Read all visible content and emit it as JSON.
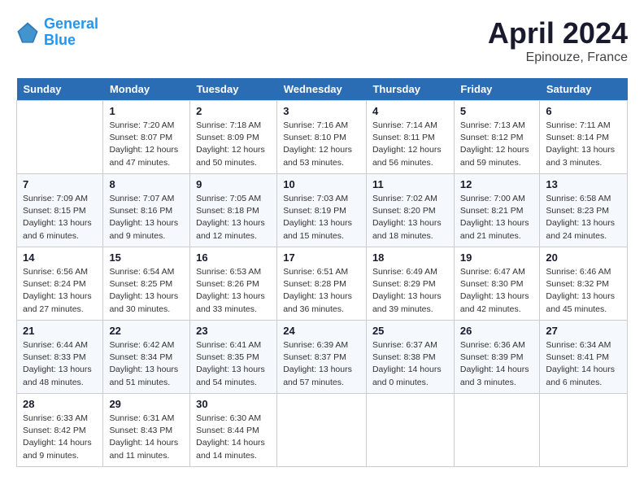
{
  "header": {
    "logo_line1": "General",
    "logo_line2": "Blue",
    "main_title": "April 2024",
    "subtitle": "Epinouze, France"
  },
  "calendar": {
    "days_of_week": [
      "Sunday",
      "Monday",
      "Tuesday",
      "Wednesday",
      "Thursday",
      "Friday",
      "Saturday"
    ],
    "weeks": [
      [
        {
          "day": "",
          "info": ""
        },
        {
          "day": "1",
          "info": "Sunrise: 7:20 AM\nSunset: 8:07 PM\nDaylight: 12 hours\nand 47 minutes."
        },
        {
          "day": "2",
          "info": "Sunrise: 7:18 AM\nSunset: 8:09 PM\nDaylight: 12 hours\nand 50 minutes."
        },
        {
          "day": "3",
          "info": "Sunrise: 7:16 AM\nSunset: 8:10 PM\nDaylight: 12 hours\nand 53 minutes."
        },
        {
          "day": "4",
          "info": "Sunrise: 7:14 AM\nSunset: 8:11 PM\nDaylight: 12 hours\nand 56 minutes."
        },
        {
          "day": "5",
          "info": "Sunrise: 7:13 AM\nSunset: 8:12 PM\nDaylight: 12 hours\nand 59 minutes."
        },
        {
          "day": "6",
          "info": "Sunrise: 7:11 AM\nSunset: 8:14 PM\nDaylight: 13 hours\nand 3 minutes."
        }
      ],
      [
        {
          "day": "7",
          "info": "Sunrise: 7:09 AM\nSunset: 8:15 PM\nDaylight: 13 hours\nand 6 minutes."
        },
        {
          "day": "8",
          "info": "Sunrise: 7:07 AM\nSunset: 8:16 PM\nDaylight: 13 hours\nand 9 minutes."
        },
        {
          "day": "9",
          "info": "Sunrise: 7:05 AM\nSunset: 8:18 PM\nDaylight: 13 hours\nand 12 minutes."
        },
        {
          "day": "10",
          "info": "Sunrise: 7:03 AM\nSunset: 8:19 PM\nDaylight: 13 hours\nand 15 minutes."
        },
        {
          "day": "11",
          "info": "Sunrise: 7:02 AM\nSunset: 8:20 PM\nDaylight: 13 hours\nand 18 minutes."
        },
        {
          "day": "12",
          "info": "Sunrise: 7:00 AM\nSunset: 8:21 PM\nDaylight: 13 hours\nand 21 minutes."
        },
        {
          "day": "13",
          "info": "Sunrise: 6:58 AM\nSunset: 8:23 PM\nDaylight: 13 hours\nand 24 minutes."
        }
      ],
      [
        {
          "day": "14",
          "info": "Sunrise: 6:56 AM\nSunset: 8:24 PM\nDaylight: 13 hours\nand 27 minutes."
        },
        {
          "day": "15",
          "info": "Sunrise: 6:54 AM\nSunset: 8:25 PM\nDaylight: 13 hours\nand 30 minutes."
        },
        {
          "day": "16",
          "info": "Sunrise: 6:53 AM\nSunset: 8:26 PM\nDaylight: 13 hours\nand 33 minutes."
        },
        {
          "day": "17",
          "info": "Sunrise: 6:51 AM\nSunset: 8:28 PM\nDaylight: 13 hours\nand 36 minutes."
        },
        {
          "day": "18",
          "info": "Sunrise: 6:49 AM\nSunset: 8:29 PM\nDaylight: 13 hours\nand 39 minutes."
        },
        {
          "day": "19",
          "info": "Sunrise: 6:47 AM\nSunset: 8:30 PM\nDaylight: 13 hours\nand 42 minutes."
        },
        {
          "day": "20",
          "info": "Sunrise: 6:46 AM\nSunset: 8:32 PM\nDaylight: 13 hours\nand 45 minutes."
        }
      ],
      [
        {
          "day": "21",
          "info": "Sunrise: 6:44 AM\nSunset: 8:33 PM\nDaylight: 13 hours\nand 48 minutes."
        },
        {
          "day": "22",
          "info": "Sunrise: 6:42 AM\nSunset: 8:34 PM\nDaylight: 13 hours\nand 51 minutes."
        },
        {
          "day": "23",
          "info": "Sunrise: 6:41 AM\nSunset: 8:35 PM\nDaylight: 13 hours\nand 54 minutes."
        },
        {
          "day": "24",
          "info": "Sunrise: 6:39 AM\nSunset: 8:37 PM\nDaylight: 13 hours\nand 57 minutes."
        },
        {
          "day": "25",
          "info": "Sunrise: 6:37 AM\nSunset: 8:38 PM\nDaylight: 14 hours\nand 0 minutes."
        },
        {
          "day": "26",
          "info": "Sunrise: 6:36 AM\nSunset: 8:39 PM\nDaylight: 14 hours\nand 3 minutes."
        },
        {
          "day": "27",
          "info": "Sunrise: 6:34 AM\nSunset: 8:41 PM\nDaylight: 14 hours\nand 6 minutes."
        }
      ],
      [
        {
          "day": "28",
          "info": "Sunrise: 6:33 AM\nSunset: 8:42 PM\nDaylight: 14 hours\nand 9 minutes."
        },
        {
          "day": "29",
          "info": "Sunrise: 6:31 AM\nSunset: 8:43 PM\nDaylight: 14 hours\nand 11 minutes."
        },
        {
          "day": "30",
          "info": "Sunrise: 6:30 AM\nSunset: 8:44 PM\nDaylight: 14 hours\nand 14 minutes."
        },
        {
          "day": "",
          "info": ""
        },
        {
          "day": "",
          "info": ""
        },
        {
          "day": "",
          "info": ""
        },
        {
          "day": "",
          "info": ""
        }
      ]
    ]
  }
}
